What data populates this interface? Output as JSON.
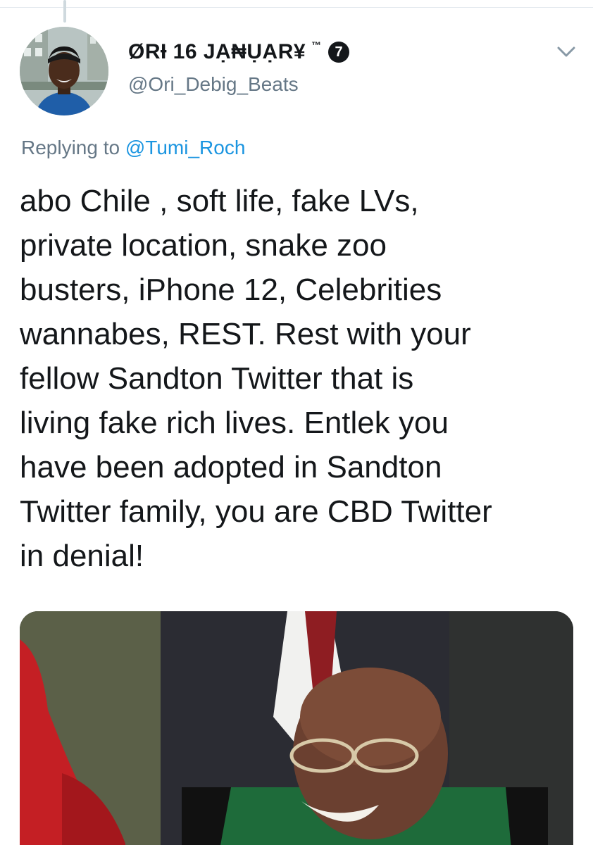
{
  "tweet": {
    "display_name": "ØRƗ 16 JẠ₦ỤẠR¥",
    "trademark": "™",
    "badge_number": "7",
    "handle": "@Ori_Debig_Beats",
    "replying_prefix": "Replying to",
    "replying_to": "@Tumi_Roch",
    "text_lines": [
      "abo Chile , soft life, fake LVs,",
      "private location, snake zoo",
      "busters, iPhone 12, Celebrities",
      "wannabes, REST. Rest with your",
      "fellow Sandton Twitter that is",
      "living fake rich lives. Entlek you",
      "have been adopted in Sandton",
      "Twitter family, you are CBD Twitter",
      "in denial!"
    ]
  },
  "icons": {
    "more": "chevron-down-icon",
    "avatar": "avatar-photo",
    "media": "tweet-photo"
  },
  "colors": {
    "text": "#14171a",
    "secondary": "#657786",
    "link": "#1b95e0",
    "divider": "#e1e8ed"
  }
}
